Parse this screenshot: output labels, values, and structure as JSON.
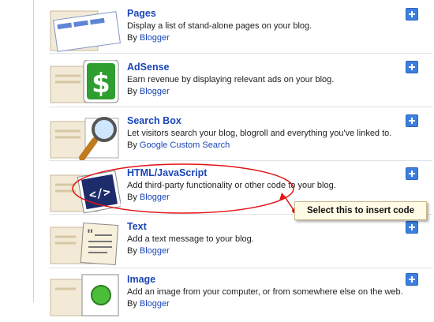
{
  "gadgets": [
    {
      "title": "Pages",
      "description": "Display a list of stand-alone pages on your blog.",
      "by_prefix": "By",
      "author": "Blogger",
      "icon": "pages-icon"
    },
    {
      "title": "AdSense",
      "description": "Earn revenue by displaying relevant ads on your blog.",
      "by_prefix": "By",
      "author": "Blogger",
      "icon": "dollar-icon"
    },
    {
      "title": "Search Box",
      "description": "Let visitors search your blog, blogroll and everything you've linked to.",
      "by_prefix": "By",
      "author": "Google Custom Search",
      "icon": "magnifier-icon"
    },
    {
      "title": "HTML/JavaScript",
      "description": "Add third-party functionality or other code to your blog.",
      "by_prefix": "By",
      "author": "Blogger",
      "icon": "code-icon"
    },
    {
      "title": "Text",
      "description": "Add a text message to your blog.",
      "by_prefix": "By",
      "author": "Blogger",
      "icon": "quote-page-icon"
    },
    {
      "title": "Image",
      "description": "Add an image from your computer, or from somewhere else on the web.",
      "by_prefix": "By",
      "author": "Blogger",
      "icon": "image-icon"
    }
  ],
  "annotation": {
    "callout_text": "Select this to insert code",
    "highlight_color": "#e01414"
  },
  "colors": {
    "link": "#1a46b8",
    "add_button": "#3d7fe0",
    "dollar_green": "#2e9e2e"
  }
}
